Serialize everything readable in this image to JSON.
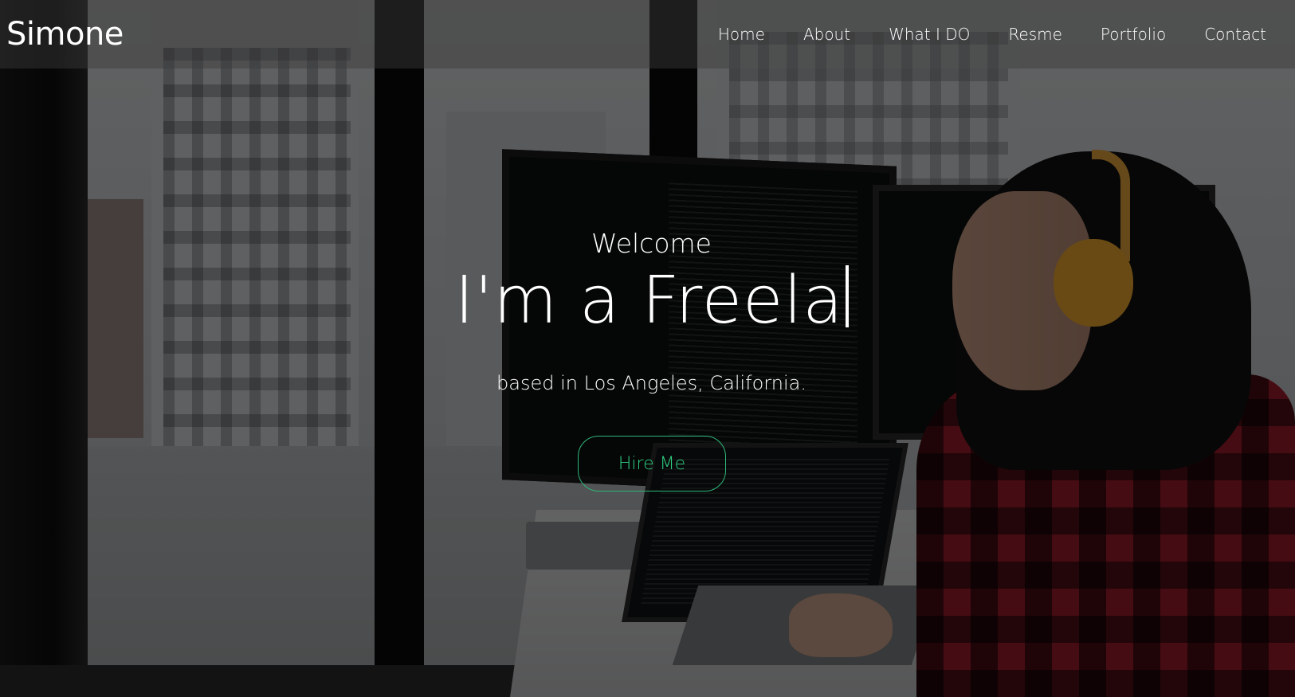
{
  "brand": {
    "name": "Simone"
  },
  "nav": {
    "items": [
      {
        "label": "Home"
      },
      {
        "label": "About"
      },
      {
        "label": "What I DO"
      },
      {
        "label": "Resme"
      },
      {
        "label": "Portfolio"
      },
      {
        "label": "Contact"
      }
    ]
  },
  "hero": {
    "welcome": "Welcome",
    "headline": "I'm a Freela",
    "location": "based in Los Angeles, California.",
    "cta_label": "Hire Me"
  },
  "colors": {
    "accent": "#2fb77b",
    "text": "#ffffff",
    "overlay": "rgba(0,0,0,0.55)"
  }
}
